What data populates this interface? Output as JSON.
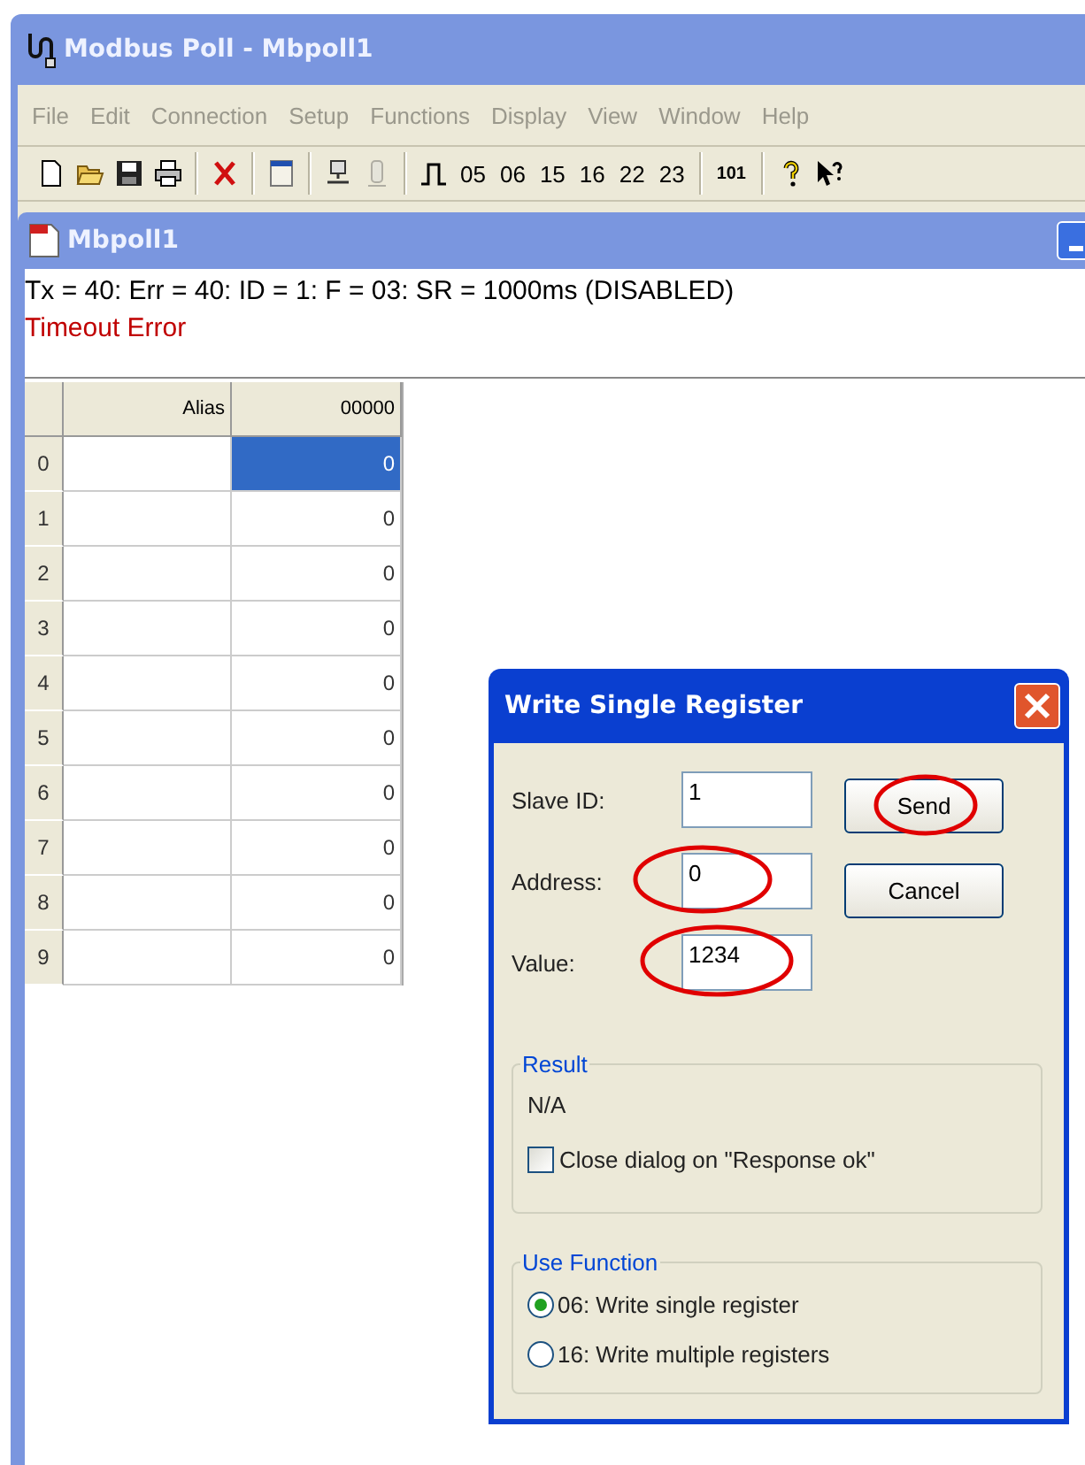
{
  "window": {
    "title": "Modbus Poll - Mbpoll1"
  },
  "menu": [
    {
      "label": "File",
      "disabled": true
    },
    {
      "label": "Edit",
      "disabled": true
    },
    {
      "label": "Connection",
      "disabled": true
    },
    {
      "label": "Setup",
      "disabled": true
    },
    {
      "label": "Functions",
      "disabled": true
    },
    {
      "label": "Display",
      "disabled": true
    },
    {
      "label": "View",
      "disabled": true
    },
    {
      "label": "Window",
      "disabled": true
    },
    {
      "label": "Help",
      "disabled": true
    }
  ],
  "toolbar": [
    {
      "kind": "icon",
      "disabled": false
    },
    {
      "kind": "icon",
      "disabled": false
    },
    {
      "kind": "icon",
      "disabled": false
    },
    {
      "kind": "icon",
      "disabled": false
    },
    {
      "kind": "separator"
    },
    {
      "kind": "icon",
      "disabled": false
    },
    {
      "kind": "separator"
    },
    {
      "kind": "icon",
      "disabled": false
    },
    {
      "kind": "separator"
    },
    {
      "kind": "icon",
      "disabled": false
    },
    {
      "kind": "icon",
      "disabled": true
    },
    {
      "kind": "separator"
    },
    {
      "kind": "icon",
      "disabled": false
    },
    {
      "kind": "text",
      "label": "05",
      "disabled": false
    },
    {
      "kind": "text",
      "label": "06",
      "disabled": false
    },
    {
      "kind": "text",
      "label": "15",
      "disabled": false
    },
    {
      "kind": "text",
      "label": "16",
      "disabled": false
    },
    {
      "kind": "text",
      "label": "22",
      "disabled": false
    },
    {
      "kind": "text",
      "label": "23",
      "disabled": false
    },
    {
      "kind": "separator"
    },
    {
      "kind": "text",
      "label": "101",
      "disabled": false,
      "small": true
    },
    {
      "kind": "separator"
    },
    {
      "kind": "icon",
      "disabled": false
    },
    {
      "kind": "icon",
      "disabled": false
    }
  ],
  "child_window": {
    "title": "Mbpoll1",
    "status": "Tx = 40: Err = 40: ID = 1: F = 03: SR = 1000ms  (DISABLED)",
    "error": "Timeout Error",
    "table": {
      "columns": [
        "Alias",
        "00000"
      ],
      "rows": [
        {
          "index": "0",
          "alias": "",
          "value": "0",
          "selected": true
        },
        {
          "index": "1",
          "alias": "",
          "value": "0",
          "selected": false
        },
        {
          "index": "2",
          "alias": "",
          "value": "0",
          "selected": false
        },
        {
          "index": "3",
          "alias": "",
          "value": "0",
          "selected": false
        },
        {
          "index": "4",
          "alias": "",
          "value": "0",
          "selected": false
        },
        {
          "index": "5",
          "alias": "",
          "value": "0",
          "selected": false
        },
        {
          "index": "6",
          "alias": "",
          "value": "0",
          "selected": false
        },
        {
          "index": "7",
          "alias": "",
          "value": "0",
          "selected": false
        },
        {
          "index": "8",
          "alias": "",
          "value": "0",
          "selected": false
        },
        {
          "index": "9",
          "alias": "",
          "value": "0",
          "selected": false
        }
      ]
    }
  },
  "dialog": {
    "title": "Write Single Register",
    "fields": [
      {
        "label": "Slave ID:",
        "value": "1",
        "highlighted": false
      },
      {
        "label": "Address:",
        "value": "0",
        "highlighted": true
      },
      {
        "label": "Value:",
        "value": "1234",
        "highlighted": true
      }
    ],
    "buttons": [
      {
        "label": "Send",
        "highlighted": true
      },
      {
        "label": "Cancel",
        "highlighted": false
      }
    ],
    "result": {
      "title": "Result",
      "text": "N/A",
      "checkbox": {
        "label": "Close dialog on \"Response ok\"",
        "checked": false
      }
    },
    "use_function": {
      "title": "Use Function",
      "options": [
        {
          "label": "06: Write single register",
          "selected": true
        },
        {
          "label": "16: Write multiple registers",
          "selected": false
        }
      ]
    }
  }
}
